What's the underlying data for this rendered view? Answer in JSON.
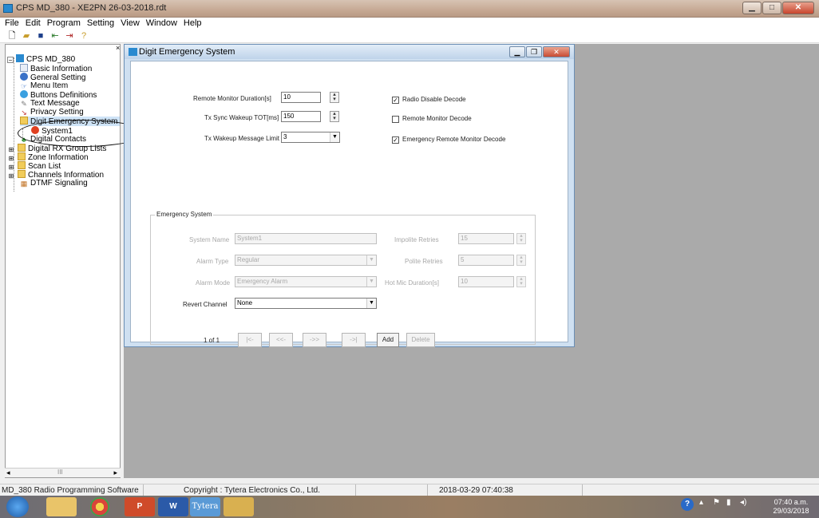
{
  "window": {
    "title": "CPS MD_380 - XE2PN 26-03-2018.rdt"
  },
  "menu": [
    "File",
    "Edit",
    "Program",
    "Setting",
    "View",
    "Window",
    "Help"
  ],
  "tree": {
    "root": "CPS MD_380",
    "items": [
      "Basic Information",
      "General Setting",
      "Menu Item",
      "Buttons Definitions",
      "Text Message",
      "Privacy Setting",
      "Digit Emergency System",
      "System1",
      "Digital Contacts",
      "Digital RX Group Lists",
      "Zone Information",
      "Scan List",
      "Channels Information",
      "DTMF Signaling"
    ],
    "scrollbar_glyph": "III"
  },
  "child_window": {
    "title": "Digit Emergency System"
  },
  "form": {
    "remote_monitor_duration": {
      "label": "Remote Monitor Duration[s]",
      "value": "10"
    },
    "tx_sync_wakeup_tot": {
      "label": "Tx Sync Wakeup TOT[ms]",
      "value": "150"
    },
    "tx_wakeup_message_limit": {
      "label": "Tx Wakeup Message Limit",
      "value": "3"
    },
    "radio_disable_decode": {
      "label": "Radio Disable Decode",
      "checked": true
    },
    "remote_monitor_decode": {
      "label": "Remote Monitor Decode",
      "checked": false
    },
    "emergency_remote_monitor_decode": {
      "label": "Emergency Remote Monitor Decode",
      "checked": true
    }
  },
  "emergency_system": {
    "group_title": "Emergency System",
    "system_name": {
      "label": "System Name",
      "value": "System1"
    },
    "alarm_type": {
      "label": "Alarm Type",
      "value": "Regular"
    },
    "alarm_mode": {
      "label": "Alarm Mode",
      "value": "Emergency Alarm"
    },
    "revert_channel": {
      "label": "Revert Channel",
      "value": "None"
    },
    "impolite_retries": {
      "label": "Impolite Retries",
      "value": "15"
    },
    "polite_retries": {
      "label": "Polite Retries",
      "value": "5"
    },
    "hot_mic_duration": {
      "label": "Hot Mic Duration[s]",
      "value": "10"
    }
  },
  "navigation": {
    "position": "1 of 1",
    "first": "|<-",
    "prev": "<<-",
    "next": "->>",
    "last": "->|",
    "add": "Add",
    "delete": "Delete"
  },
  "status_bar": {
    "app": "MD_380 Radio Programming Software",
    "copyright": "Copyright : Tytera Electronics Co., Ltd.",
    "datetime": "2018-03-29 07:40:38"
  },
  "taskbar": {
    "apps": [
      "P",
      "W",
      "Tytera"
    ],
    "clock_time": "07:40 a.m.",
    "clock_date": "29/03/2018"
  }
}
